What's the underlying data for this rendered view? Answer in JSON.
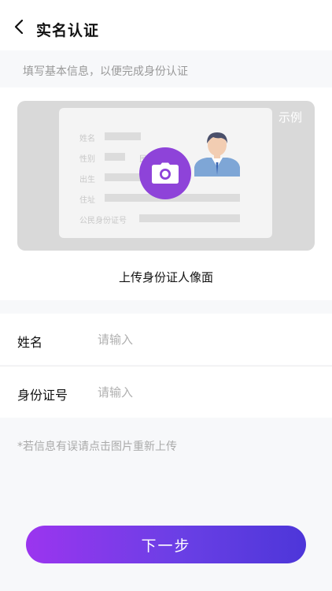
{
  "header": {
    "title": "实名认证",
    "back_icon": "chevron-left-icon"
  },
  "hint": {
    "text": "填写基本信息，以便完成身份认证"
  },
  "upload": {
    "example_tag": "示例",
    "card_fields": [
      "姓名",
      "性别",
      "出生",
      "住址",
      "公民身份证号"
    ],
    "card_partial_text": "民",
    "camera_icon": "camera-icon",
    "label": "上传身份证人像面"
  },
  "form": {
    "name_label": "姓名",
    "name_placeholder": "请输入",
    "id_label": "身份证号",
    "id_placeholder": "请输入"
  },
  "note": "*若信息有误请点击图片重新上传",
  "next_button": "下一步",
  "colors": {
    "accent_start": "#9b35ef",
    "accent_end": "#4d36d9",
    "camera_bg": "#8e43d9"
  }
}
